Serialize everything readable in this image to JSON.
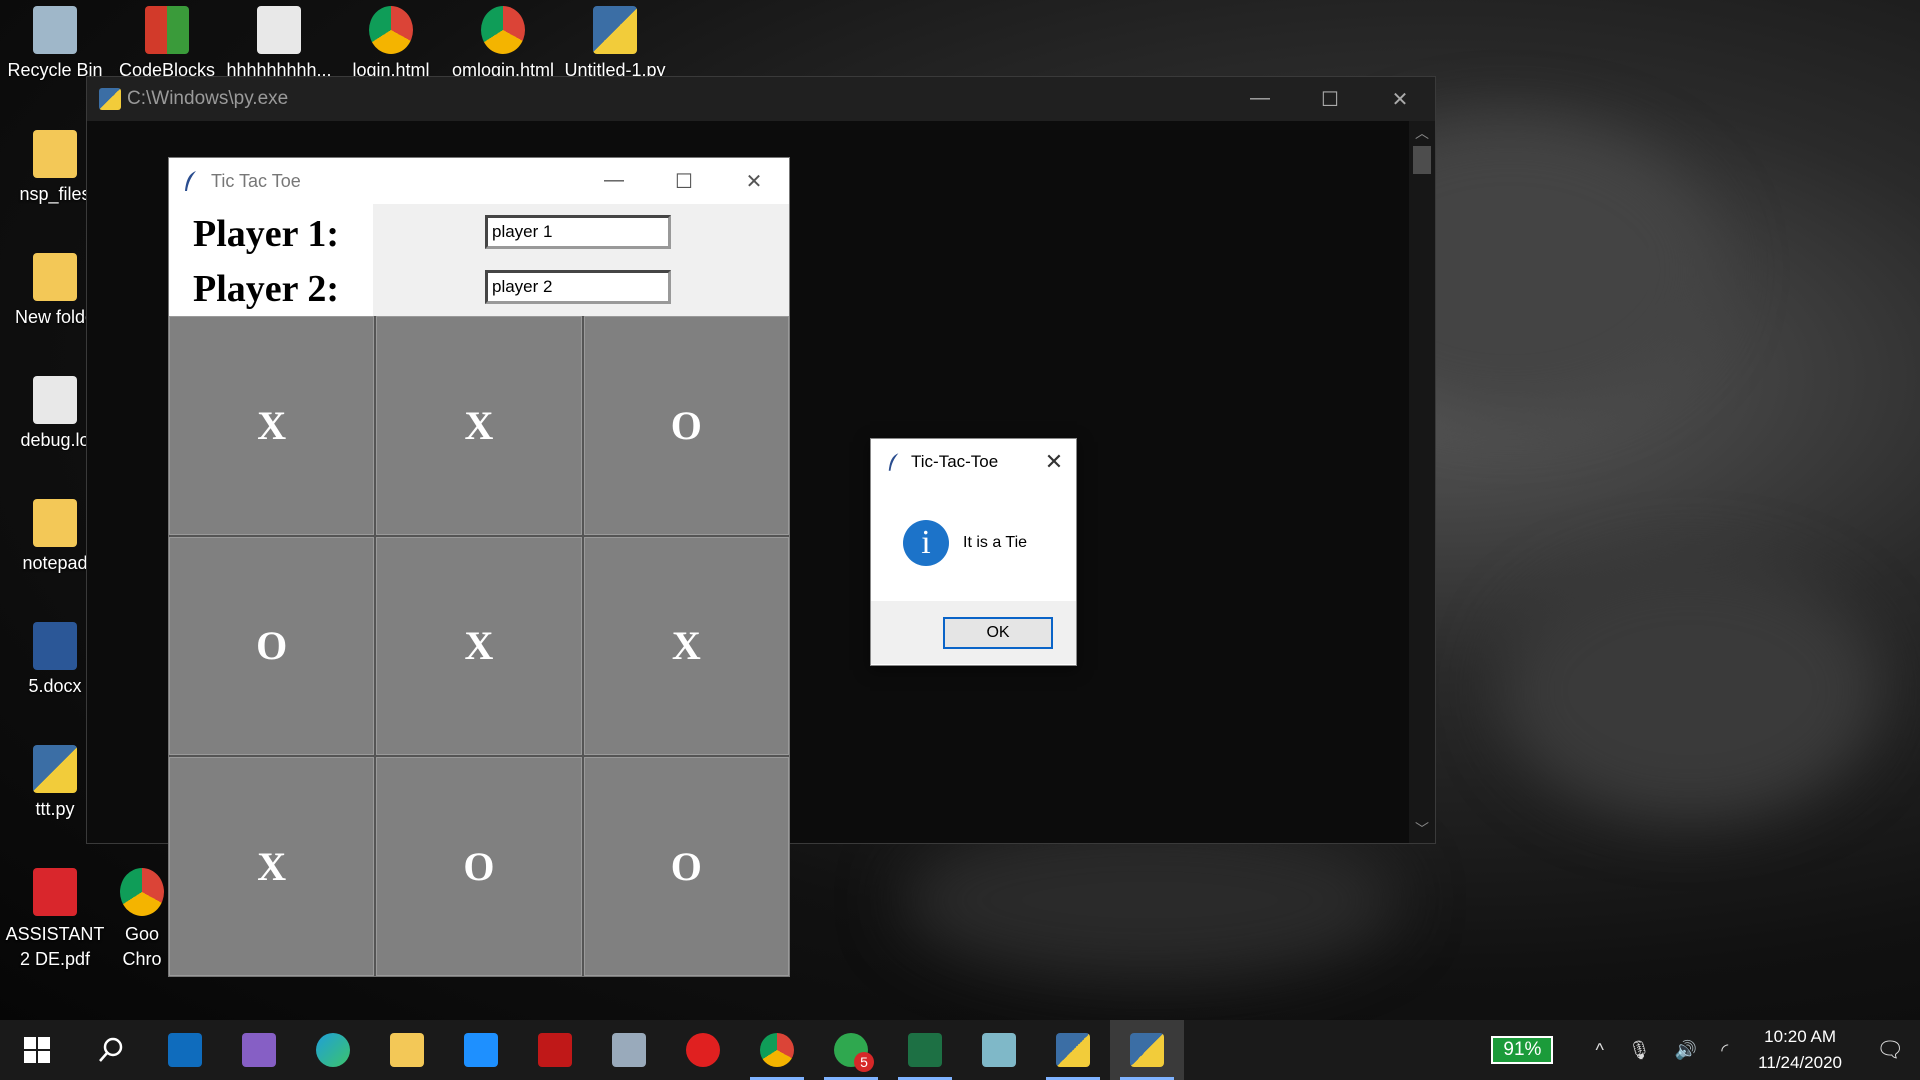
{
  "desktop": {
    "icons": [
      {
        "label": "Recycle Bin",
        "icon": "recycle-bin-icon",
        "color": "#9fb7c9"
      },
      {
        "label": "CodeBlocks",
        "icon": "codeblocks-icon",
        "color": "#d23a2a"
      },
      {
        "label": "hhhhhhhhh...",
        "icon": "text-file-icon",
        "color": "#e8e8e8"
      },
      {
        "label": "login.html",
        "icon": "chrome-icon",
        "color": "#3b8d3b"
      },
      {
        "label": "omlogin.html",
        "icon": "chrome-icon",
        "color": "#3b8d3b"
      },
      {
        "label": "Untitled-1.py",
        "icon": "python-file-icon",
        "color": "#3b6ea5"
      },
      {
        "label": "nsp_files",
        "icon": "folder-icon",
        "color": "#f3c857"
      },
      {
        "label": "New folde",
        "icon": "folder-icon",
        "color": "#f3c857"
      },
      {
        "label": "debug.lo",
        "icon": "text-file-icon",
        "color": "#e8e8e8"
      },
      {
        "label": "notepad",
        "icon": "folder-icon",
        "color": "#f3c857"
      },
      {
        "label": "5.docx",
        "icon": "word-icon",
        "color": "#2b5797"
      },
      {
        "label": "ttt.py",
        "icon": "python-file-icon",
        "color": "#3b6ea5"
      },
      {
        "label": "ASSISTANT 2 DE.pdf",
        "icon": "pdf-icon",
        "color": "#d9262c"
      },
      {
        "label": "Goo Chro",
        "icon": "chrome-shortcut-icon",
        "color": "#3b8d3b"
      }
    ]
  },
  "console": {
    "title": "C:\\Windows\\py.exe",
    "minimize": "—",
    "maximize": "☐",
    "close": "✕"
  },
  "ttt_window": {
    "title": "Tic Tac Toe",
    "minimize": "—",
    "maximize": "☐",
    "close": "✕",
    "player1_label": "Player 1:",
    "player2_label": "Player 2:",
    "player1_value": "player 1",
    "player2_value": "player 2",
    "board": [
      "X",
      "X",
      "O",
      "O",
      "X",
      "X",
      "X",
      "O",
      "O"
    ]
  },
  "dialog": {
    "title": "Tic-Tac-Toe",
    "close": "✕",
    "info_glyph": "i",
    "message": "It is a Tie",
    "ok_label": "OK"
  },
  "taskbar": {
    "items": [
      {
        "icon": "windows-start-icon",
        "color": "#ffffff"
      },
      {
        "icon": "search-icon",
        "color": "#ffffff"
      },
      {
        "icon": "mail-icon",
        "color": "#0f6cbd"
      },
      {
        "icon": "visual-studio-icon",
        "color": "#865fc5"
      },
      {
        "icon": "edge-icon",
        "color": "#1f9fd8"
      },
      {
        "icon": "file-explorer-icon",
        "color": "#f3c857"
      },
      {
        "icon": "l-app-icon",
        "color": "#1e90ff"
      },
      {
        "icon": "mcafee-icon",
        "color": "#c01818"
      },
      {
        "icon": "laptop-app-icon",
        "color": "#9ab"
      },
      {
        "icon": "youtube-music-icon",
        "color": "#e02020"
      },
      {
        "icon": "chrome-icon",
        "color": "#3b8d3b"
      },
      {
        "icon": "whatsapp-icon",
        "color": "#2fa84f"
      },
      {
        "icon": "excel-icon",
        "color": "#1d7044"
      },
      {
        "icon": "notes-icon",
        "color": "#7fb8c8"
      },
      {
        "icon": "python-launcher-icon",
        "color": "#3b6ea5"
      },
      {
        "icon": "python-app-icon",
        "color": "#3b6ea5"
      }
    ],
    "whatsapp_badge": "5",
    "battery": "91%",
    "time": "10:20 AM",
    "date": "11/24/2020",
    "chevron": "^",
    "notification_glyph": "🗨"
  }
}
